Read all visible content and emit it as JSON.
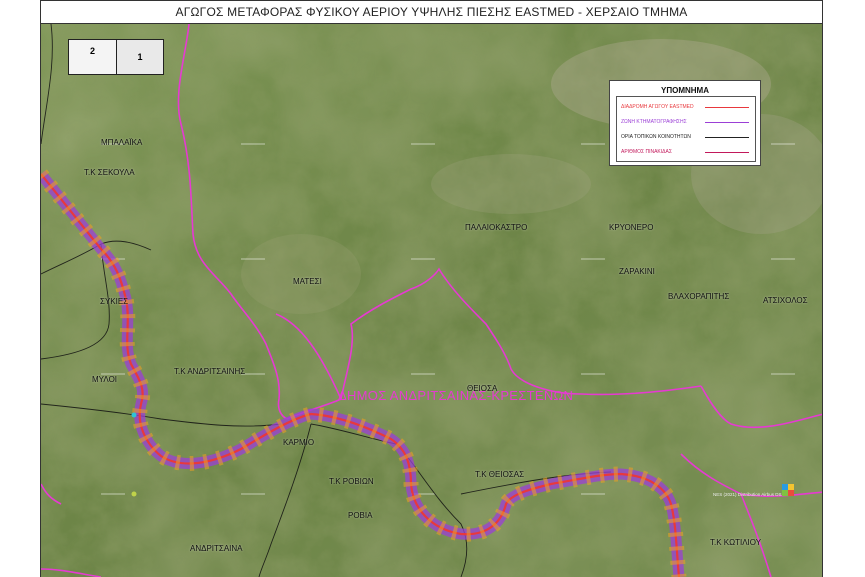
{
  "title": "ΑΓΩΓΟΣ ΜΕΤΑΦΟΡΑΣ ΦΥΣΙΚΟΥ ΑΕΡΙΟΥ ΥΨΗΛΗΣ ΠΙΕΣΗΣ EASTMED - ΧΕΡΣΑΙΟ ΤΜΗΜΑ",
  "sheet_index": {
    "left": "2",
    "right": "1"
  },
  "legend": {
    "title": "ΥΠΟΜΝΗΜΑ",
    "items": [
      {
        "label": "ΔΙΑΔΡΟΜΗ ΑΓΩΓΟΥ EASTMED",
        "color": "#e8383d"
      },
      {
        "label": "ΖΩΝΗ ΚΤΗΜΑΤΟΓΡΑΦΗΣΗΣ",
        "color": "#9b3fd6"
      },
      {
        "label": "ΟΡΙΑ ΤΟΠΙΚΩΝ ΚΟΙΝΟΤΗΤΩΝ",
        "color": "#222222"
      },
      {
        "label": "ΑΡΙΘΜΟΣ ΠΙΝΑΚΙΔΑΣ",
        "color": "#c2185b"
      }
    ]
  },
  "municipality_label": "ΔΗΜΟΣ ΑΝΔΡΙΤΣΑΙΝΑΣ-ΚΡΕΣΤΕΝΩΝ",
  "place_labels": {
    "bablaika": "ΜΠΑΛΑΪΚΑ",
    "tk_sekoulas": "Τ.Κ ΣΕΚΟΥΛΑ",
    "sykies": "ΣΥΚΙΕΣ",
    "mylos": "ΜΥΛΟΙ",
    "tk_andritsainis": "Τ.Κ ΑΝΔΡΙΤΣΑΙΝΗΣ",
    "matesi": "ΜΑΤΕΣΙ",
    "palaiokastro": "ΠΑΛΑΙΟΚΑΣΤΡΟ",
    "kryonero": "ΚΡΥΟΝΕΡΟ",
    "zarakini": "ΖΑΡΑΚΙΝΙ",
    "vlachorapitis": "ΒΛΑΧΟΡΑΠΙΤΗΣ",
    "atsicholos": "ΑΤΣΙΧΟΛΟΣ",
    "theiosa": "ΘΕΙΟΣΑ",
    "karmios": "ΚΑΡΜΙΟ",
    "tk_rovion": "Τ.Κ ΡΟΒΙΩΝ",
    "rovia": "ΡΟΒΙΑ",
    "tk_theiosas": "Τ.Κ ΘΕΙΟΣΑΣ",
    "andritsaina": "ΑΝΔΡΙΤΣΑΙΝΑ",
    "tk_kotiliou": "Τ.Κ ΚΩΤΙΛΙΟΥ"
  },
  "attribution": "NES (2021) Distribution Airbus DS",
  "colors": {
    "terrain_light": "#8ea062",
    "terrain_mid": "#6e8648",
    "terrain_dark": "#4d6534",
    "boundary_magenta": "#e63ad2",
    "pipeline_zone": "#9b3fd6",
    "pipeline_core": "#e8383d",
    "pipeline_buffer": "#f0a020"
  }
}
